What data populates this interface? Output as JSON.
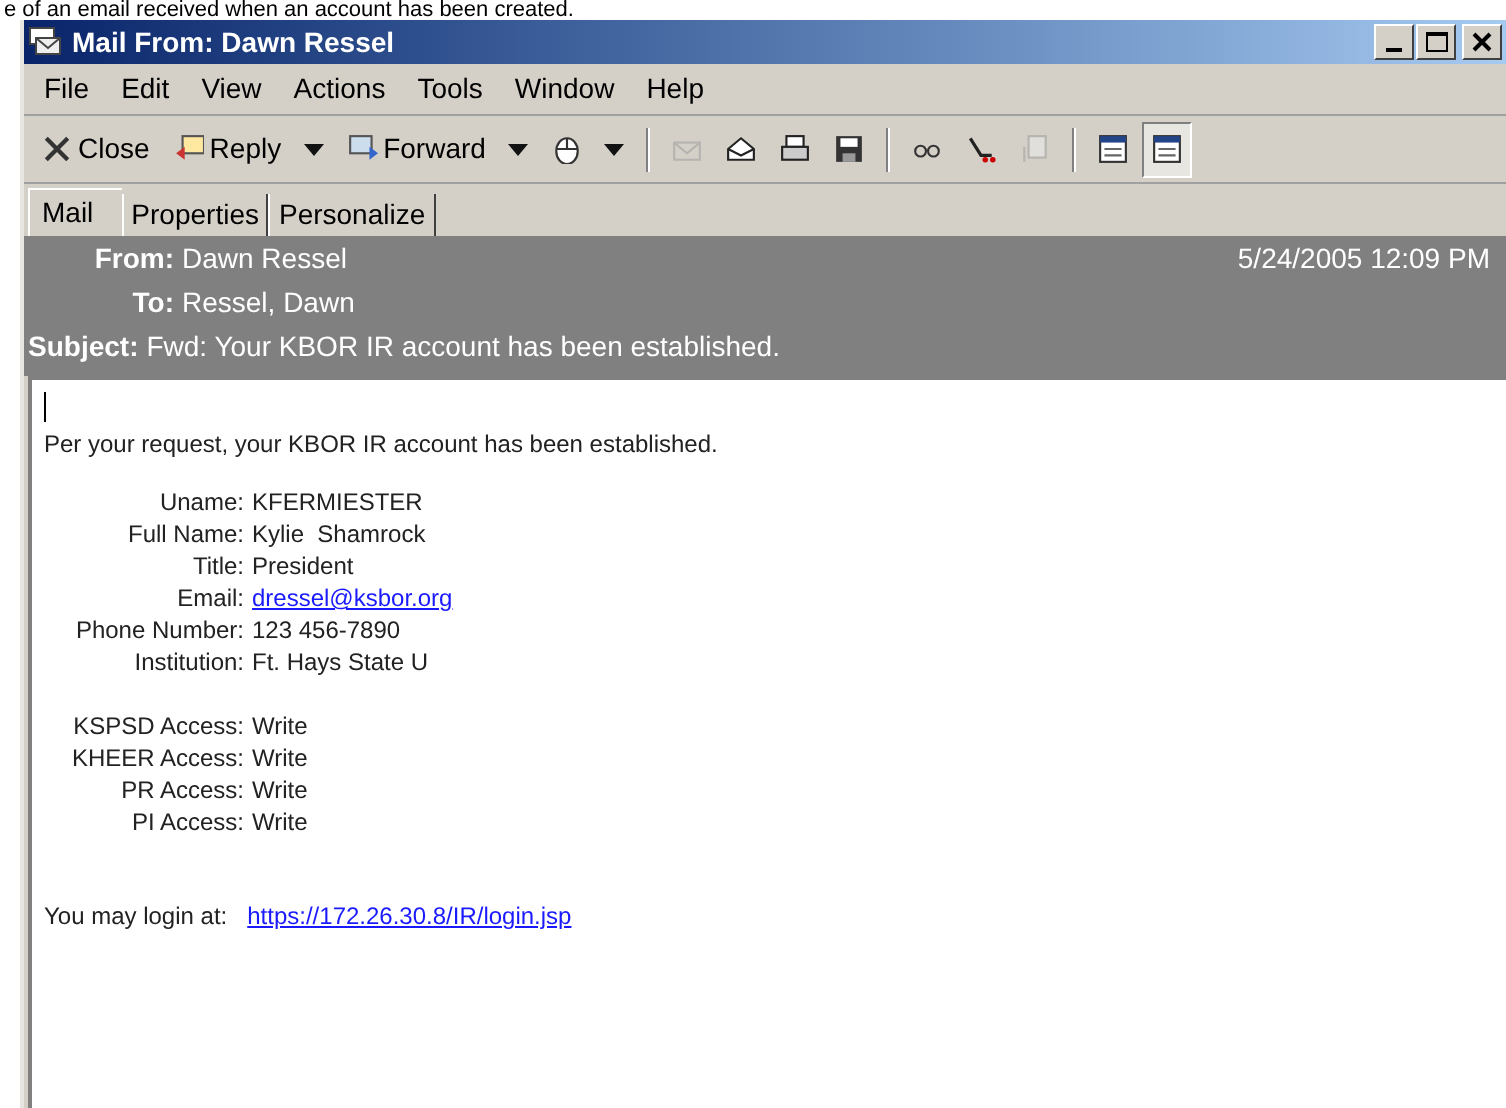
{
  "caption": "e of an email received when an account has been created.",
  "window": {
    "title": "Mail From: Dawn Ressel"
  },
  "menu": [
    "File",
    "Edit",
    "View",
    "Actions",
    "Tools",
    "Window",
    "Help"
  ],
  "toolbar": [
    {
      "kind": "text",
      "label": "Close",
      "dropdown": false,
      "pressed": false,
      "disabled": false
    },
    {
      "kind": "text",
      "label": "Reply",
      "dropdown": true,
      "pressed": false,
      "disabled": false
    },
    {
      "kind": "text",
      "label": "Forward",
      "dropdown": true,
      "pressed": false,
      "disabled": false
    },
    {
      "kind": "icon",
      "dropdown": true,
      "pressed": false,
      "disabled": false
    },
    {
      "kind": "sep"
    },
    {
      "kind": "icon",
      "dropdown": false,
      "pressed": false,
      "disabled": true
    },
    {
      "kind": "icon",
      "dropdown": false,
      "pressed": false,
      "disabled": false
    },
    {
      "kind": "icon",
      "dropdown": false,
      "pressed": false,
      "disabled": false
    },
    {
      "kind": "icon",
      "dropdown": false,
      "pressed": false,
      "disabled": false
    },
    {
      "kind": "sep"
    },
    {
      "kind": "icon",
      "dropdown": false,
      "pressed": false,
      "disabled": false
    },
    {
      "kind": "icon",
      "dropdown": false,
      "pressed": false,
      "disabled": false
    },
    {
      "kind": "icon",
      "dropdown": false,
      "pressed": false,
      "disabled": true
    },
    {
      "kind": "sep"
    },
    {
      "kind": "icon",
      "dropdown": false,
      "pressed": false,
      "disabled": false
    },
    {
      "kind": "icon",
      "dropdown": false,
      "pressed": true,
      "disabled": false
    }
  ],
  "tabs": [
    {
      "label": "Mail",
      "selected": true
    },
    {
      "label": "Properties",
      "selected": false
    },
    {
      "label": "Personalize",
      "selected": false
    }
  ],
  "header": {
    "from_label": "From:",
    "from": "Dawn Ressel",
    "date": "5/24/2005 12:09 PM",
    "to_label": "To:",
    "to": "Ressel, Dawn",
    "subject_label": "Subject:",
    "subject": "Fwd: Your KBOR IR account has been established."
  },
  "body": {
    "intro": "Per your request, your KBOR IR account has been established.",
    "groups": [
      [
        {
          "label": "Uname:",
          "value": "KFERMIESTER",
          "kind": "text"
        },
        {
          "label": "Full Name:",
          "value": "Kylie  Shamrock",
          "kind": "text"
        },
        {
          "label": "Title:",
          "value": "President",
          "kind": "text"
        },
        {
          "label": "Email:",
          "value": "dressel@ksbor.org",
          "kind": "link"
        },
        {
          "label": "Phone Number:",
          "value": "123 456-7890",
          "kind": "text"
        },
        {
          "label": "Institution:",
          "value": "Ft. Hays State U",
          "kind": "text"
        }
      ],
      [
        {
          "label": "KSPSD Access:",
          "value": "Write",
          "kind": "text"
        },
        {
          "label": "KHEER Access:",
          "value": "Write",
          "kind": "text"
        },
        {
          "label": "PR Access:",
          "value": "Write",
          "kind": "text"
        },
        {
          "label": "PI Access:",
          "value": "Write",
          "kind": "text"
        }
      ]
    ],
    "login_label": "You may login at:",
    "login_url": "https://172.26.30.8/IR/login.jsp"
  }
}
